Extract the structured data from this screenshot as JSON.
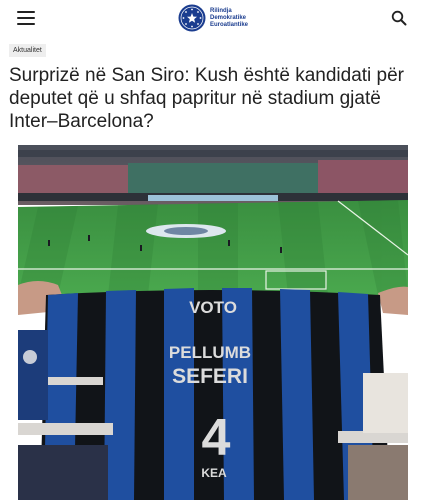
{
  "header": {
    "logo_lines": [
      "Rilindja",
      "Demokratike",
      "Euroatlantike"
    ]
  },
  "article": {
    "category": "Aktualitet",
    "title": "Surprizë në San Siro: Kush është kandidati për deputet që u shfaq papritur në stadium gjatë Inter–Barcelona?",
    "jersey": {
      "top_text": "VOTO",
      "name_line1": "PELLUMB",
      "name_line2": "SEFERI",
      "number": "4",
      "bottom_text": "KEA"
    }
  },
  "icons": {
    "menu": "hamburger-menu-icon",
    "search": "search-icon",
    "logo": "star-circle-emblem"
  },
  "colors": {
    "brand": "#1b3d8f",
    "pitch": "#3f9d45",
    "jersey_blue": "#1f4fa0",
    "jersey_black": "#111418"
  }
}
